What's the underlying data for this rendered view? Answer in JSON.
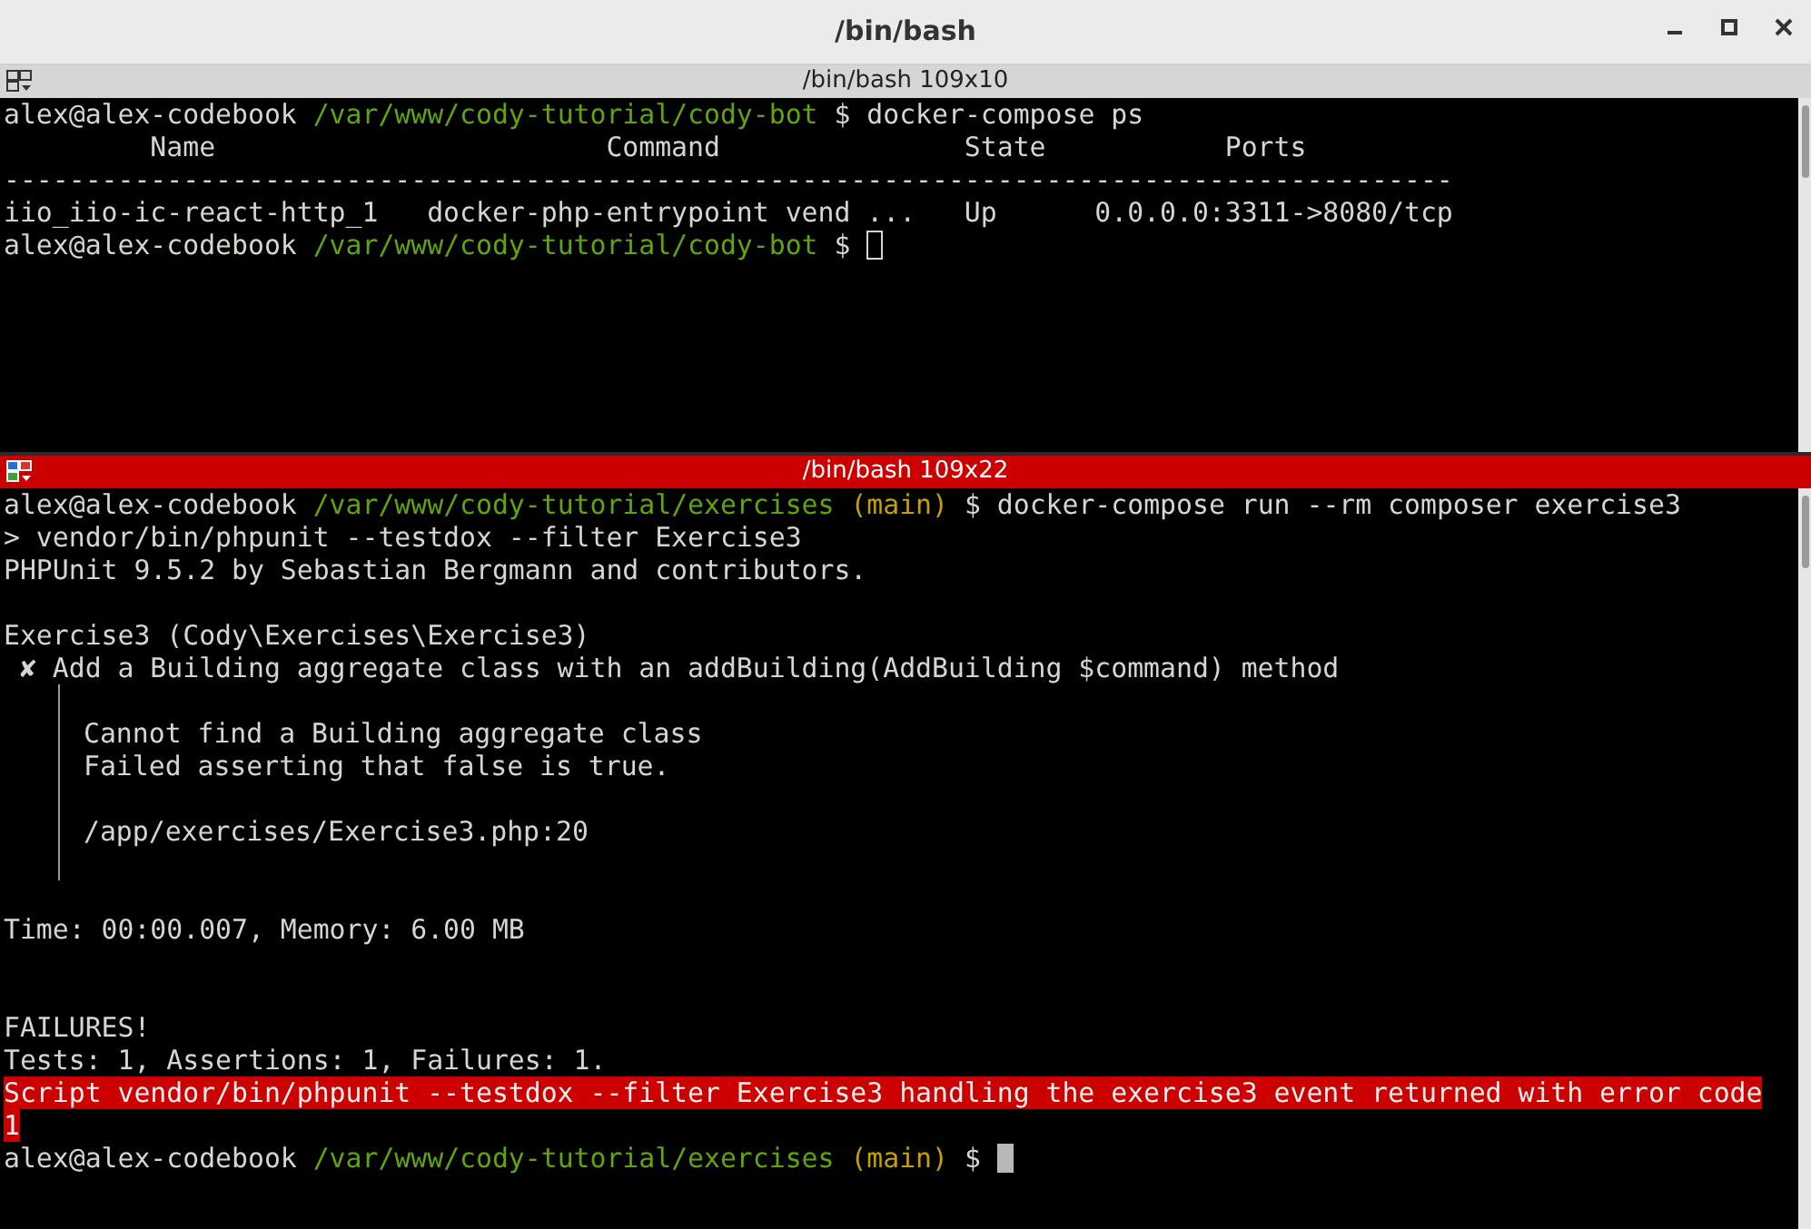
{
  "window": {
    "title": "/bin/bash"
  },
  "panes": [
    {
      "title": "/bin/bash 109x10",
      "focused": false,
      "lines": [
        {
          "kind": "output",
          "segments": [
            {
              "kind": "user",
              "text": "alex@alex-codebook "
            },
            {
              "kind": "path",
              "text": "/var/www/cody-tutorial/cody-bot"
            },
            {
              "kind": "text",
              "text": " $ docker-compose ps"
            }
          ]
        },
        {
          "kind": "output",
          "segments": [
            {
              "kind": "text",
              "text": "         Name                        Command               State           Ports"
            }
          ]
        },
        {
          "kind": "output",
          "segments": [
            {
              "kind": "text",
              "text": "-----------------------------------------------------------------------------------------"
            }
          ]
        },
        {
          "kind": "output",
          "segments": [
            {
              "kind": "text",
              "text": "iio_iio-ic-react-http_1   docker-php-entrypoint vend ...   Up      0.0.0.0:3311->8080/tcp"
            }
          ]
        },
        {
          "kind": "output",
          "segments": [
            {
              "kind": "user",
              "text": "alex@alex-codebook "
            },
            {
              "kind": "path",
              "text": "/var/www/cody-tutorial/cody-bot"
            },
            {
              "kind": "text",
              "text": " $ "
            }
          ],
          "cursor": true
        }
      ]
    },
    {
      "title": "/bin/bash 109x22",
      "focused": true,
      "lines": [
        {
          "kind": "output",
          "segments": [
            {
              "kind": "user",
              "text": "alex@alex-codebook "
            },
            {
              "kind": "path",
              "text": "/var/www/cody-tutorial/exercises"
            },
            {
              "kind": "branch",
              "text": " (main)"
            },
            {
              "kind": "text",
              "text": " $ docker-compose run --rm composer exercise3"
            }
          ]
        },
        {
          "kind": "output",
          "segments": [
            {
              "kind": "text",
              "text": "> vendor/bin/phpunit --testdox --filter Exercise3"
            }
          ]
        },
        {
          "kind": "output",
          "segments": [
            {
              "kind": "text",
              "text": "PHPUnit 9.5.2 by Sebastian Bergmann and contributors."
            }
          ]
        },
        {
          "kind": "blank"
        },
        {
          "kind": "output",
          "segments": [
            {
              "kind": "text",
              "text": "Exercise3 (Cody\\Exercises\\Exercise3)"
            }
          ]
        },
        {
          "kind": "output",
          "segments": [
            {
              "kind": "text",
              "text": " ✘ Add a Building aggregate class with an addBuilding(AddBuilding $command) method"
            }
          ]
        },
        {
          "kind": "detail_gap"
        },
        {
          "kind": "detail",
          "segments": [
            {
              "kind": "text",
              "text": "Cannot find a Building aggregate class"
            }
          ]
        },
        {
          "kind": "detail",
          "segments": [
            {
              "kind": "text",
              "text": "Failed asserting that false is true."
            }
          ]
        },
        {
          "kind": "detail_gap"
        },
        {
          "kind": "detail",
          "segments": [
            {
              "kind": "text",
              "text": "/app/exercises/Exercise3.php:20"
            }
          ]
        },
        {
          "kind": "detail_gap"
        },
        {
          "kind": "blank"
        },
        {
          "kind": "output",
          "segments": [
            {
              "kind": "text",
              "text": "Time: 00:00.007, Memory: 6.00 MB"
            }
          ]
        },
        {
          "kind": "blank"
        },
        {
          "kind": "blank"
        },
        {
          "kind": "output",
          "segments": [
            {
              "kind": "text",
              "text": "FAILURES!"
            }
          ]
        },
        {
          "kind": "output",
          "segments": [
            {
              "kind": "text",
              "text": "Tests: 1, Assertions: 1, Failures: 1."
            }
          ]
        },
        {
          "kind": "output",
          "segments": [
            {
              "kind": "error",
              "text": "Script vendor/bin/phpunit --testdox --filter Exercise3 handling the exercise3 event returned with error code"
            }
          ]
        },
        {
          "kind": "output",
          "segments": [
            {
              "kind": "error",
              "text": "1"
            }
          ]
        },
        {
          "kind": "output",
          "segments": [
            {
              "kind": "user",
              "text": "alex@alex-codebook "
            },
            {
              "kind": "path",
              "text": "/var/www/cody-tutorial/exercises"
            },
            {
              "kind": "branch",
              "text": " (main)"
            },
            {
              "kind": "text",
              "text": " $ "
            }
          ],
          "cursor": true
        }
      ]
    }
  ]
}
